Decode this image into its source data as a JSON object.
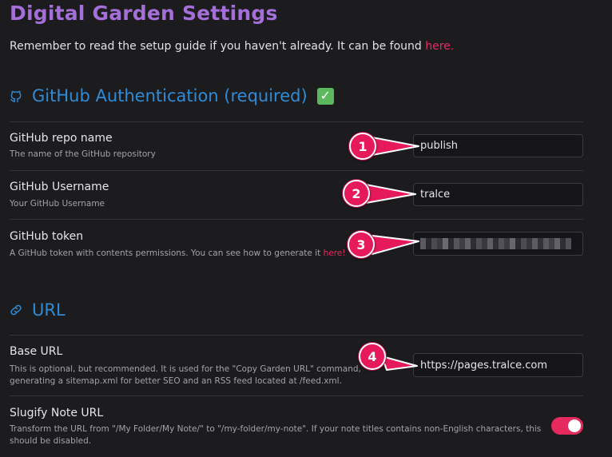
{
  "page": {
    "title": "Digital Garden Settings",
    "intro_text": "Remember to read the setup guide if you haven't already. It can be found ",
    "intro_link": "here."
  },
  "github_section": {
    "heading": "GitHub Authentication (required)",
    "icon": "github-icon",
    "status_icon": "checkmark-icon",
    "status_mark": "✓",
    "settings": [
      {
        "name": "GitHub repo name",
        "description": "The name of the GitHub repository",
        "value": "publish"
      },
      {
        "name": "GitHub Username",
        "description": "Your GitHub Username",
        "value": "tralce"
      },
      {
        "name": "GitHub token",
        "description": "A GitHub token with contents permissions. You can see how to generate it ",
        "description_link": "here!",
        "value_obscured": true
      }
    ]
  },
  "url_section": {
    "heading": "URL",
    "icon": "link-icon",
    "settings": [
      {
        "name": "Base URL",
        "description": "This is optional, but recommended. It is used for the \"Copy Garden URL\" command, generating a sitemap.xml for better SEO and an RSS feed located at /feed.xml.",
        "value": "https://pages.tralce.com"
      },
      {
        "name": "Slugify Note URL",
        "description": "Transform the URL from \"/My Folder/My Note/\" to \"/my-folder/my-note\". If your note titles contains non-English characters, this should be disabled.",
        "toggle_on": true
      }
    ]
  },
  "annotations": {
    "labels": [
      "1",
      "2",
      "3",
      "4"
    ]
  },
  "colors": {
    "title": "#a46fd8",
    "heading": "#2f8bd6",
    "accent": "#e62a5f",
    "background": "#1c1c1f",
    "callout": "#e6195a"
  }
}
